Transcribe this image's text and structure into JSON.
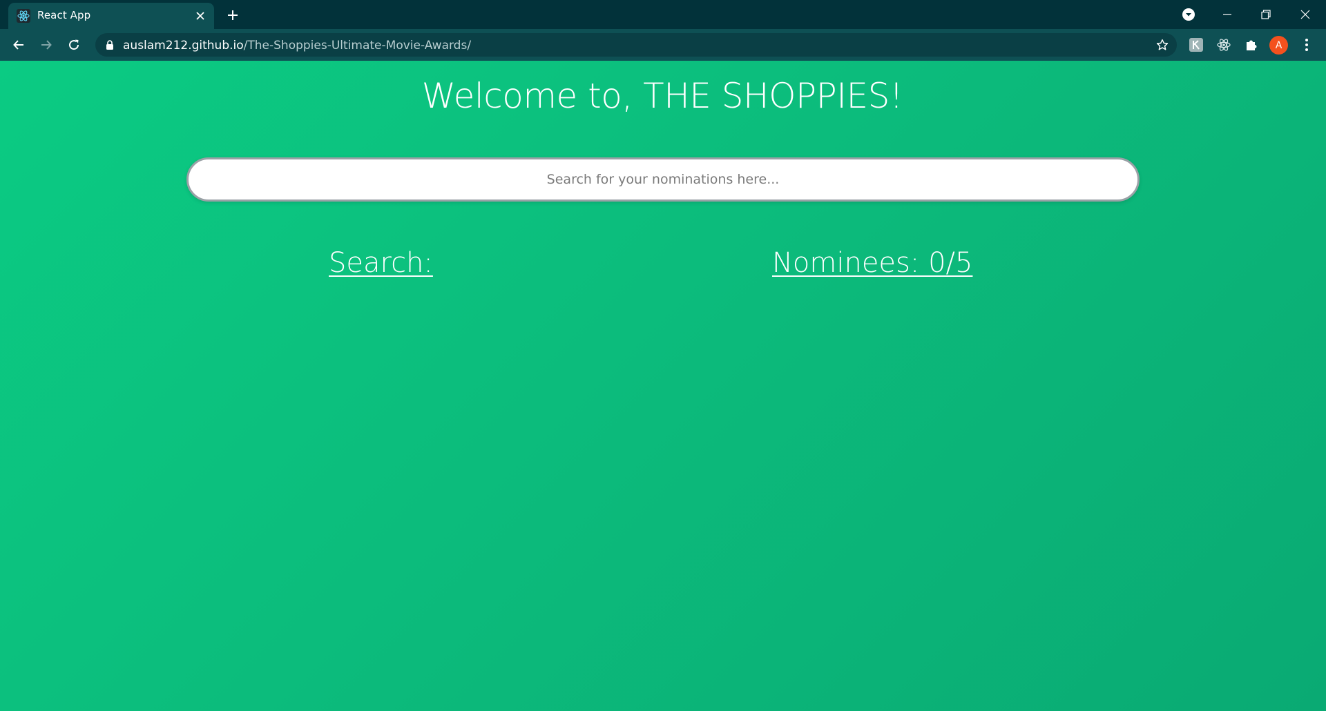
{
  "browser": {
    "tab": {
      "title": "React App",
      "favicon": "react-icon",
      "close_icon": "close-icon"
    },
    "new_tab_icon": "plus-icon",
    "window_controls": [
      "dropdown-icon",
      "minimize-icon",
      "restore-icon",
      "close-icon"
    ],
    "url": {
      "domain": "auslam212.github.io",
      "path": "/The-Shoppies-Ultimate-Movie-Awards/"
    },
    "extensions": [
      "extension-k-icon",
      "react-devtools-icon",
      "puzzle-icon"
    ],
    "profile_initial": "A",
    "colors": {
      "titlebar": "#02323a",
      "toolbar": "#0e5054",
      "avatar": "#f4511e"
    }
  },
  "page": {
    "title": "Welcome to, THE SHOPPIES!",
    "search": {
      "placeholder": "Search for your nominations here...",
      "value": ""
    },
    "results_heading": "Search:",
    "nominees_heading": "Nominees: 0/5",
    "colors": {
      "gradient_start": "#0bcb83",
      "gradient_end": "#0aaa73"
    }
  }
}
